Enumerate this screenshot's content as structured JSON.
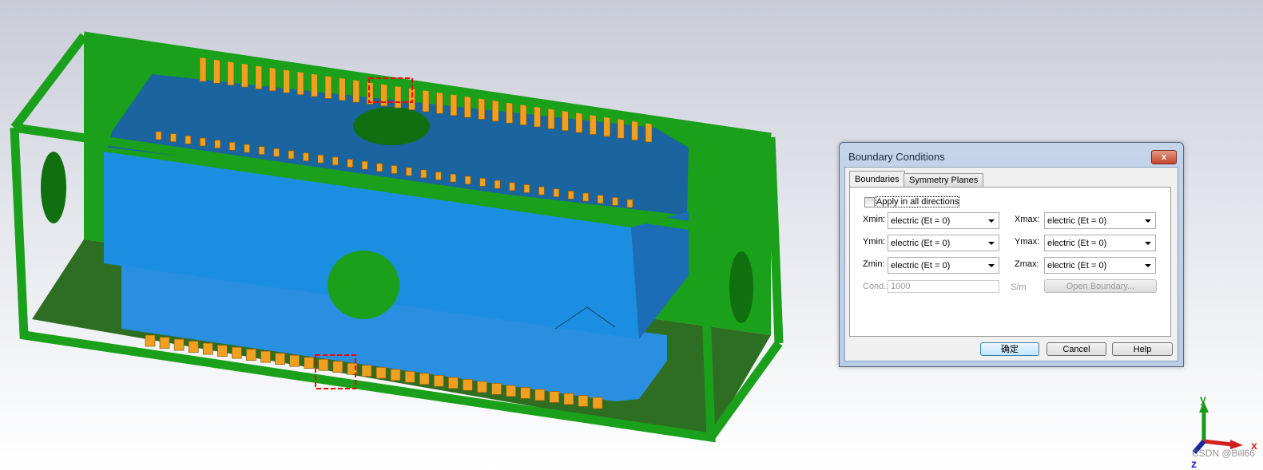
{
  "dialog": {
    "title": "Boundary Conditions",
    "close_label": "x",
    "tabs": [
      {
        "label": "Boundaries",
        "active": true
      },
      {
        "label": "Symmetry Planes",
        "active": false
      }
    ],
    "apply_all_label": "Apply in all directions",
    "apply_all_checked": false,
    "rows": [
      {
        "min_label": "Xmin:",
        "min_value": "electric (Et = 0)",
        "max_label": "Xmax:",
        "max_value": "electric (Et = 0)"
      },
      {
        "min_label": "Ymin:",
        "min_value": "electric (Et = 0)",
        "max_label": "Ymax:",
        "max_value": "electric (Et = 0)"
      },
      {
        "min_label": "Zmin:",
        "min_value": "electric (Et = 0)",
        "max_label": "Zmax:",
        "max_value": "electric (Et = 0)"
      }
    ],
    "cond_label": "Cond.:",
    "cond_value": "1000",
    "cond_unit": "S/m",
    "open_boundary_label": "Open Boundary...",
    "ok_label": "确定",
    "cancel_label": "Cancel",
    "help_label": "Help"
  },
  "axes": {
    "x": "x",
    "y": "y",
    "z": "z"
  },
  "watermark": "CSDN @Bill66",
  "colors": {
    "frame": "#1aa01a",
    "floor": "#2f7a1f",
    "body_front": "#1c8fe0",
    "body_top": "#1a64a0",
    "pins": "#f0a020",
    "highlight": "#ff0000"
  }
}
